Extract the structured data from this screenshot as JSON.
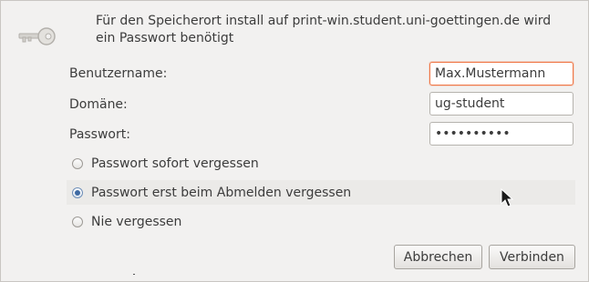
{
  "dialog": {
    "message": "Für den Speicherort install auf print-win.student.uni-goettingen.de wird ein Passwort benötigt"
  },
  "fields": {
    "username": {
      "label": "Benutzername:",
      "value": "Max.Mustermann"
    },
    "domain": {
      "label": "Domäne:",
      "value": "ug-student"
    },
    "password": {
      "label": "Passwort:",
      "value": "••••••••••"
    }
  },
  "remember_options": [
    {
      "label": "Passwort sofort vergessen",
      "checked": false
    },
    {
      "label": "Passwort erst beim Abmelden vergessen",
      "checked": true
    },
    {
      "label": "Nie vergessen",
      "checked": false
    }
  ],
  "buttons": {
    "cancel": "Abbrechen",
    "connect": "Verbinden"
  },
  "colors": {
    "background": "#f2f1f0",
    "focus_border": "#f07746",
    "radio_selected": "#3f6aa3"
  },
  "icons": {
    "dialog": "key-icon",
    "pointer": "mouse-pointer-icon"
  }
}
